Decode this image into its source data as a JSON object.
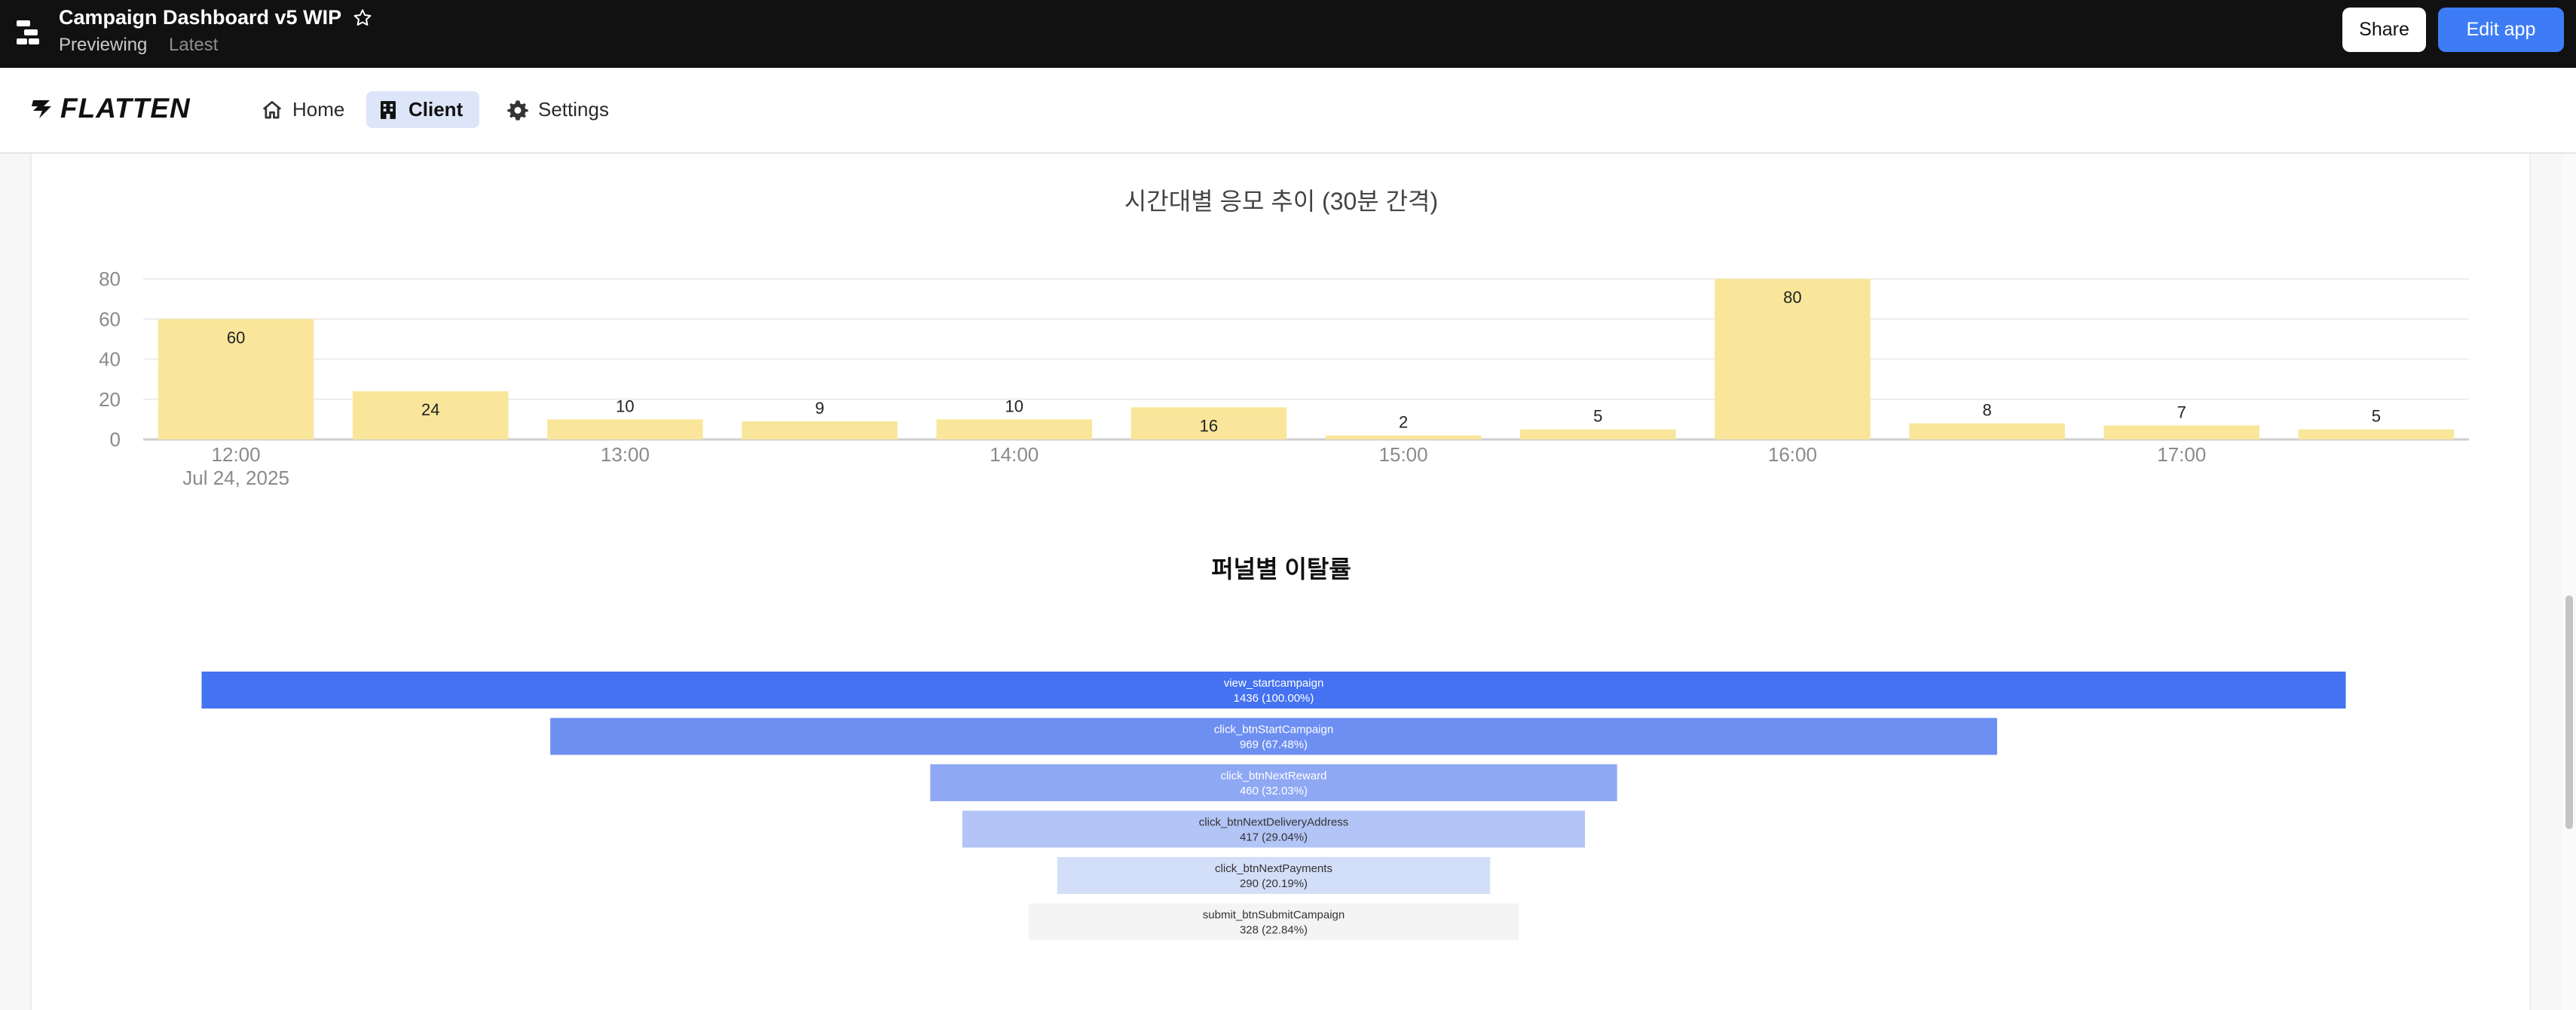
{
  "app": {
    "title": "Campaign Dashboard v5 WIP",
    "status_previewing": "Previewing",
    "status_latest": "Latest",
    "share_label": "Share",
    "edit_label": "Edit app"
  },
  "nav": {
    "logo": "FLATTEN",
    "items": [
      {
        "label": "Home",
        "icon": "home-icon",
        "active": false
      },
      {
        "label": "Client",
        "icon": "building-icon",
        "active": true
      },
      {
        "label": "Settings",
        "icon": "gear-icon",
        "active": false
      }
    ]
  },
  "colors": {
    "bar_fill": "#f9e69a",
    "accent": "#3d7cf4",
    "active_nav_bg": "#dde6f8"
  },
  "chart_data": [
    {
      "type": "bar",
      "title": "시간대별 응모 추이 (30분 간격)",
      "x": [
        "12:00",
        "12:30",
        "13:00",
        "13:30",
        "14:00",
        "14:30",
        "15:00",
        "15:30",
        "16:00",
        "16:30",
        "17:00",
        "17:30"
      ],
      "values": [
        60,
        24,
        10,
        9,
        10,
        16,
        2,
        5,
        80,
        8,
        7,
        5
      ],
      "xtick_labels": [
        "12:00",
        "13:00",
        "14:00",
        "15:00",
        "16:00",
        "17:00"
      ],
      "xtick_sublabel": "Jul 24, 2025",
      "ytick_labels": [
        "0",
        "20",
        "40",
        "60",
        "80"
      ],
      "ylim": [
        0,
        80
      ],
      "grid": true
    },
    {
      "type": "funnel",
      "title": "퍼널별 이탈률",
      "stages": [
        {
          "name": "view_startcampaign",
          "value": 1436,
          "percent": "1436 (100.00%)",
          "color": "#4472f0"
        },
        {
          "name": "click_btnStartCampaign",
          "value": 969,
          "percent": "969 (67.48%)",
          "color": "#6d8ff2"
        },
        {
          "name": "click_btnNextReward",
          "value": 460,
          "percent": "460 (32.03%)",
          "color": "#8ea8f4"
        },
        {
          "name": "click_btnNextDeliveryAddress",
          "value": 417,
          "percent": "417 (29.04%)",
          "color": "#b3c4f6"
        },
        {
          "name": "click_btnNextPayments",
          "value": 290,
          "percent": "290 (20.19%)",
          "color": "#d3def8"
        },
        {
          "name": "submit_btnSubmitCampaign",
          "value": 328,
          "percent": "328 (22.84%)",
          "color": "#f4f4f4"
        }
      ]
    }
  ]
}
